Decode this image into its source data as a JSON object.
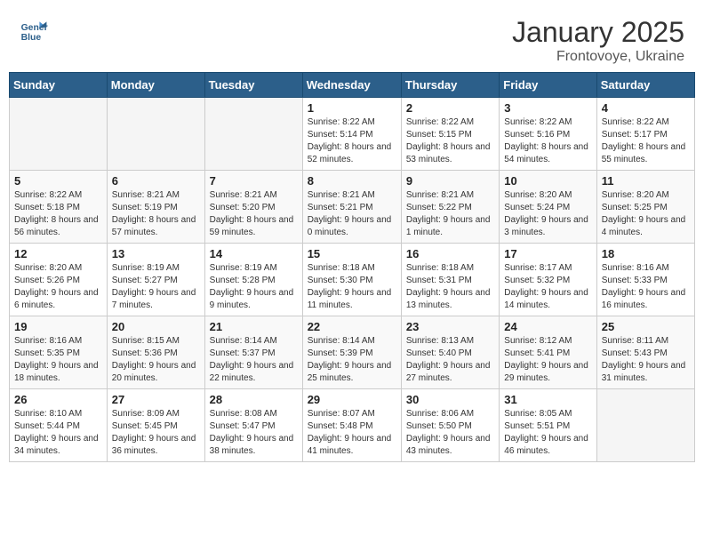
{
  "header": {
    "logo_general": "General",
    "logo_blue": "Blue",
    "month": "January 2025",
    "location": "Frontovoye, Ukraine"
  },
  "weekdays": [
    "Sunday",
    "Monday",
    "Tuesday",
    "Wednesday",
    "Thursday",
    "Friday",
    "Saturday"
  ],
  "weeks": [
    [
      {
        "day": "",
        "info": ""
      },
      {
        "day": "",
        "info": ""
      },
      {
        "day": "",
        "info": ""
      },
      {
        "day": "1",
        "info": "Sunrise: 8:22 AM\nSunset: 5:14 PM\nDaylight: 8 hours and 52 minutes."
      },
      {
        "day": "2",
        "info": "Sunrise: 8:22 AM\nSunset: 5:15 PM\nDaylight: 8 hours and 53 minutes."
      },
      {
        "day": "3",
        "info": "Sunrise: 8:22 AM\nSunset: 5:16 PM\nDaylight: 8 hours and 54 minutes."
      },
      {
        "day": "4",
        "info": "Sunrise: 8:22 AM\nSunset: 5:17 PM\nDaylight: 8 hours and 55 minutes."
      }
    ],
    [
      {
        "day": "5",
        "info": "Sunrise: 8:22 AM\nSunset: 5:18 PM\nDaylight: 8 hours and 56 minutes."
      },
      {
        "day": "6",
        "info": "Sunrise: 8:21 AM\nSunset: 5:19 PM\nDaylight: 8 hours and 57 minutes."
      },
      {
        "day": "7",
        "info": "Sunrise: 8:21 AM\nSunset: 5:20 PM\nDaylight: 8 hours and 59 minutes."
      },
      {
        "day": "8",
        "info": "Sunrise: 8:21 AM\nSunset: 5:21 PM\nDaylight: 9 hours and 0 minutes."
      },
      {
        "day": "9",
        "info": "Sunrise: 8:21 AM\nSunset: 5:22 PM\nDaylight: 9 hours and 1 minute."
      },
      {
        "day": "10",
        "info": "Sunrise: 8:20 AM\nSunset: 5:24 PM\nDaylight: 9 hours and 3 minutes."
      },
      {
        "day": "11",
        "info": "Sunrise: 8:20 AM\nSunset: 5:25 PM\nDaylight: 9 hours and 4 minutes."
      }
    ],
    [
      {
        "day": "12",
        "info": "Sunrise: 8:20 AM\nSunset: 5:26 PM\nDaylight: 9 hours and 6 minutes."
      },
      {
        "day": "13",
        "info": "Sunrise: 8:19 AM\nSunset: 5:27 PM\nDaylight: 9 hours and 7 minutes."
      },
      {
        "day": "14",
        "info": "Sunrise: 8:19 AM\nSunset: 5:28 PM\nDaylight: 9 hours and 9 minutes."
      },
      {
        "day": "15",
        "info": "Sunrise: 8:18 AM\nSunset: 5:30 PM\nDaylight: 9 hours and 11 minutes."
      },
      {
        "day": "16",
        "info": "Sunrise: 8:18 AM\nSunset: 5:31 PM\nDaylight: 9 hours and 13 minutes."
      },
      {
        "day": "17",
        "info": "Sunrise: 8:17 AM\nSunset: 5:32 PM\nDaylight: 9 hours and 14 minutes."
      },
      {
        "day": "18",
        "info": "Sunrise: 8:16 AM\nSunset: 5:33 PM\nDaylight: 9 hours and 16 minutes."
      }
    ],
    [
      {
        "day": "19",
        "info": "Sunrise: 8:16 AM\nSunset: 5:35 PM\nDaylight: 9 hours and 18 minutes."
      },
      {
        "day": "20",
        "info": "Sunrise: 8:15 AM\nSunset: 5:36 PM\nDaylight: 9 hours and 20 minutes."
      },
      {
        "day": "21",
        "info": "Sunrise: 8:14 AM\nSunset: 5:37 PM\nDaylight: 9 hours and 22 minutes."
      },
      {
        "day": "22",
        "info": "Sunrise: 8:14 AM\nSunset: 5:39 PM\nDaylight: 9 hours and 25 minutes."
      },
      {
        "day": "23",
        "info": "Sunrise: 8:13 AM\nSunset: 5:40 PM\nDaylight: 9 hours and 27 minutes."
      },
      {
        "day": "24",
        "info": "Sunrise: 8:12 AM\nSunset: 5:41 PM\nDaylight: 9 hours and 29 minutes."
      },
      {
        "day": "25",
        "info": "Sunrise: 8:11 AM\nSunset: 5:43 PM\nDaylight: 9 hours and 31 minutes."
      }
    ],
    [
      {
        "day": "26",
        "info": "Sunrise: 8:10 AM\nSunset: 5:44 PM\nDaylight: 9 hours and 34 minutes."
      },
      {
        "day": "27",
        "info": "Sunrise: 8:09 AM\nSunset: 5:45 PM\nDaylight: 9 hours and 36 minutes."
      },
      {
        "day": "28",
        "info": "Sunrise: 8:08 AM\nSunset: 5:47 PM\nDaylight: 9 hours and 38 minutes."
      },
      {
        "day": "29",
        "info": "Sunrise: 8:07 AM\nSunset: 5:48 PM\nDaylight: 9 hours and 41 minutes."
      },
      {
        "day": "30",
        "info": "Sunrise: 8:06 AM\nSunset: 5:50 PM\nDaylight: 9 hours and 43 minutes."
      },
      {
        "day": "31",
        "info": "Sunrise: 8:05 AM\nSunset: 5:51 PM\nDaylight: 9 hours and 46 minutes."
      },
      {
        "day": "",
        "info": ""
      }
    ]
  ]
}
